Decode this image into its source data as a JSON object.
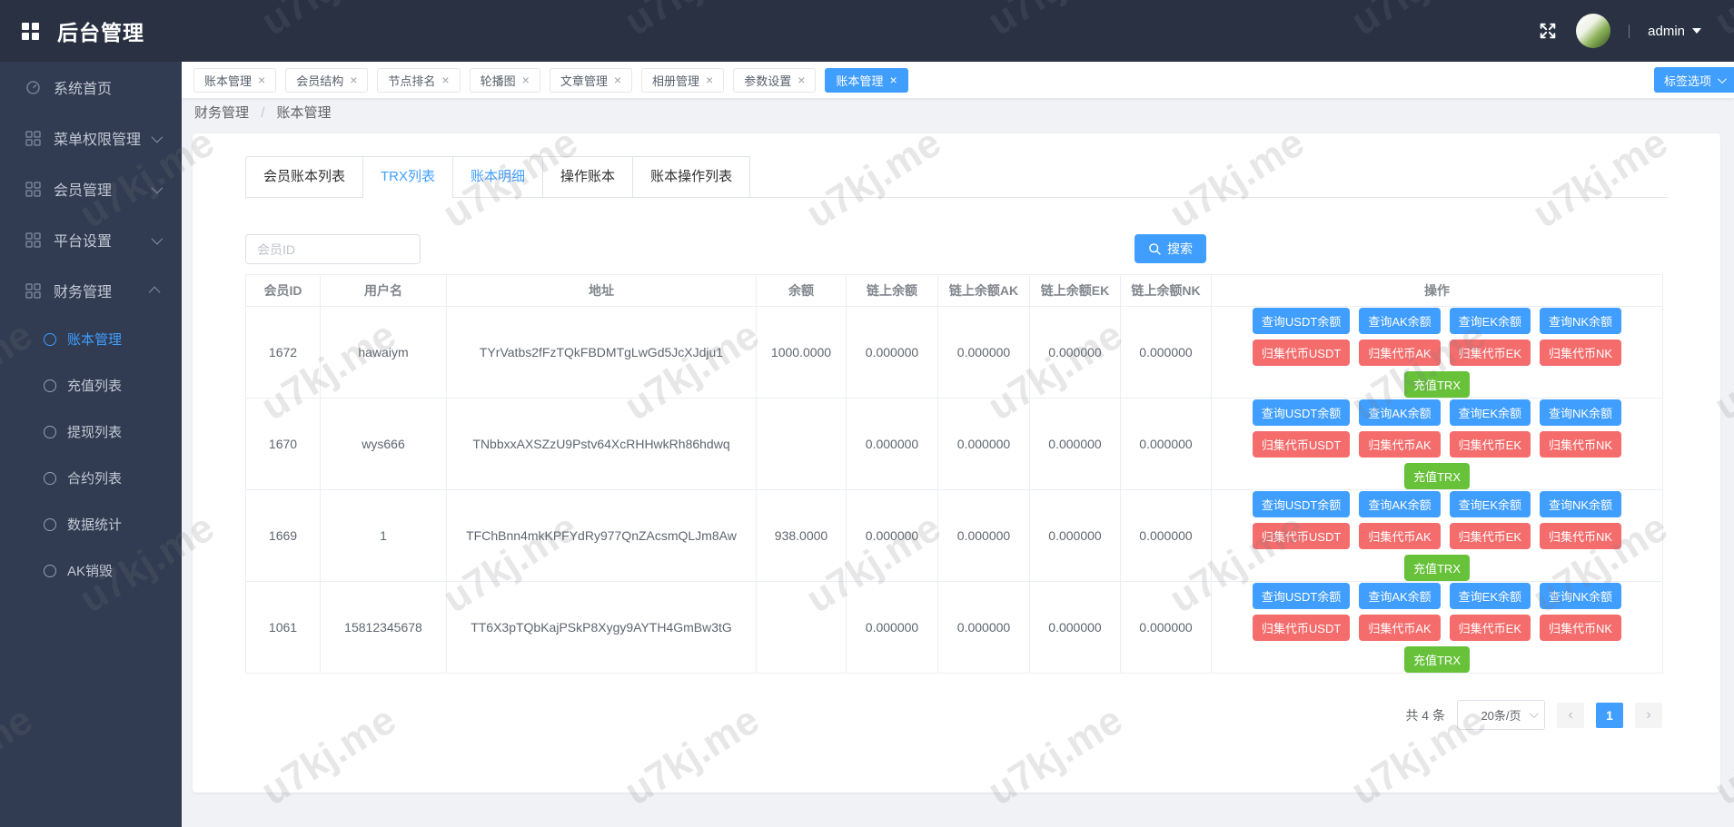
{
  "app": {
    "title": "后台管理",
    "user": "admin"
  },
  "colors": {
    "primary": "#409eff",
    "danger": "#f56c6c",
    "success": "#67c23a",
    "topbar_bg": "#293142",
    "sidebar_bg": "#313b51",
    "page_bg": "#f0f2f5"
  },
  "icons": {
    "close": "×"
  },
  "watermark": {
    "text": "u7kj.me"
  },
  "sidebar": {
    "items": [
      {
        "label": "系统首页",
        "icon": "dashboard-icon",
        "state": null
      },
      {
        "label": "菜单权限管理",
        "icon": "grid-icon",
        "state": "collapsed"
      },
      {
        "label": "会员管理",
        "icon": "grid-icon",
        "state": "collapsed"
      },
      {
        "label": "平台设置",
        "icon": "grid-icon",
        "state": "collapsed"
      },
      {
        "label": "财务管理",
        "icon": "grid-icon",
        "state": "expanded",
        "children": [
          {
            "label": "账本管理",
            "active": true
          },
          {
            "label": "充值列表",
            "active": false
          },
          {
            "label": "提现列表",
            "active": false
          },
          {
            "label": "合约列表",
            "active": false
          },
          {
            "label": "数据统计",
            "active": false
          },
          {
            "label": "AK销毁",
            "active": false
          }
        ]
      }
    ]
  },
  "tagbar": {
    "options_button": "标签选项",
    "tabs": [
      {
        "label": "账本管理",
        "active": false
      },
      {
        "label": "会员结构",
        "active": false
      },
      {
        "label": "节点排名",
        "active": false
      },
      {
        "label": "轮播图",
        "active": false
      },
      {
        "label": "文章管理",
        "active": false
      },
      {
        "label": "相册管理",
        "active": false
      },
      {
        "label": "参数设置",
        "active": false
      },
      {
        "label": "账本管理",
        "active": true
      }
    ]
  },
  "breadcrumb": {
    "items": [
      "财务管理",
      "账本管理"
    ],
    "separator": "/"
  },
  "panel": {
    "tabs": [
      {
        "label": "会员账本列表",
        "active": false,
        "highlight": false
      },
      {
        "label": "TRX列表",
        "active": true,
        "highlight": true
      },
      {
        "label": "账本明细",
        "active": false,
        "highlight": true
      },
      {
        "label": "操作账本",
        "active": false,
        "highlight": false
      },
      {
        "label": "账本操作列表",
        "active": false,
        "highlight": false
      }
    ],
    "search": {
      "placeholder": "会员ID",
      "button": "搜索"
    },
    "table": {
      "columns": [
        "会员ID",
        "用户名",
        "地址",
        "余额",
        "链上余额",
        "链上余额AK",
        "链上余额EK",
        "链上余额NK",
        "操作"
      ],
      "rows": [
        {
          "member_id": "1672",
          "username": "hawaiym",
          "address": "TYrVatbs2fFzTQkFBDMTgLwGd5JcXJdju1",
          "balance": "1000.0000",
          "chain_balance": "0.000000",
          "chain_ak": "0.000000",
          "chain_ek": "0.000000",
          "chain_nk": "0.000000"
        },
        {
          "member_id": "1670",
          "username": "wys666",
          "address": "TNbbxxAXSZzU9Pstv64XcRHHwkRh86hdwq",
          "balance": "",
          "chain_balance": "0.000000",
          "chain_ak": "0.000000",
          "chain_ek": "0.000000",
          "chain_nk": "0.000000"
        },
        {
          "member_id": "1669",
          "username": "1",
          "address": "TFChBnn4mkKPFYdRy977QnZAcsmQLJm8Aw",
          "balance": "938.0000",
          "chain_balance": "0.000000",
          "chain_ak": "0.000000",
          "chain_ek": "0.000000",
          "chain_nk": "0.000000"
        },
        {
          "member_id": "1061",
          "username": "15812345678",
          "address": "TT6X3pTQbKajPSkP8Xygy9AYTH4GmBw3tG",
          "balance": "",
          "chain_balance": "0.000000",
          "chain_ak": "0.000000",
          "chain_ek": "0.000000",
          "chain_nk": "0.000000"
        }
      ],
      "row_actions": {
        "query": [
          "查询USDT余额",
          "查询AK余额",
          "查询EK余额",
          "查询NK余额"
        ],
        "collect": [
          "归集代币USDT",
          "归集代币AK",
          "归集代币EK",
          "归集代币NK"
        ],
        "recharge": [
          "充值TRX"
        ]
      }
    },
    "pagination": {
      "total": "共 4 条",
      "page_size": "20条/页",
      "prev": "‹",
      "current": "1",
      "next": "›"
    }
  }
}
